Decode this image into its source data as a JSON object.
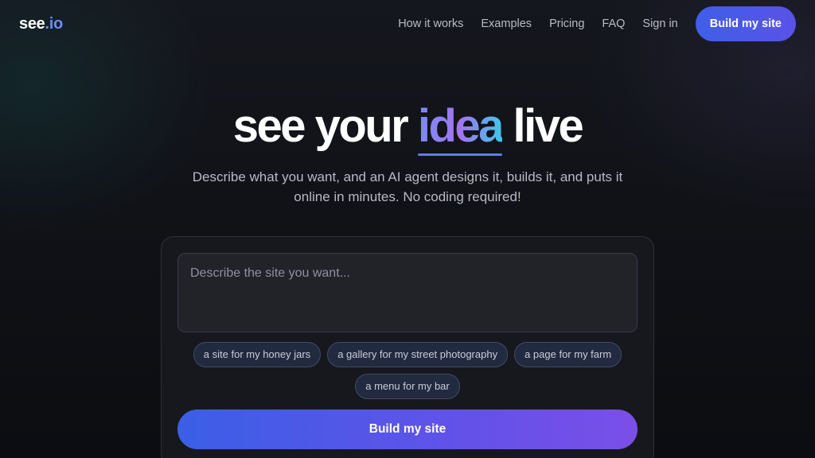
{
  "header": {
    "logo_main": "see",
    "logo_accent": ".io",
    "nav": [
      "How it works",
      "Examples",
      "Pricing",
      "FAQ",
      "Sign in"
    ],
    "cta_label": "Build my site"
  },
  "hero": {
    "title_before": "see your ",
    "title_accent": "idea",
    "title_after": " live",
    "subtitle": "Describe what you want, and an AI agent designs it, builds it, and puts it online in minutes. No coding required!"
  },
  "form": {
    "placeholder": "Describe the site you want...",
    "value": "",
    "suggestions": [
      "a site for my honey jars",
      "a gallery for my street photography",
      "a page for my farm",
      "a menu for my bar"
    ],
    "submit_label": "Build my site"
  },
  "colors": {
    "accent": "#6d8cf7",
    "button_start": "#3a5fe6",
    "button_end": "#7a4fe8"
  }
}
